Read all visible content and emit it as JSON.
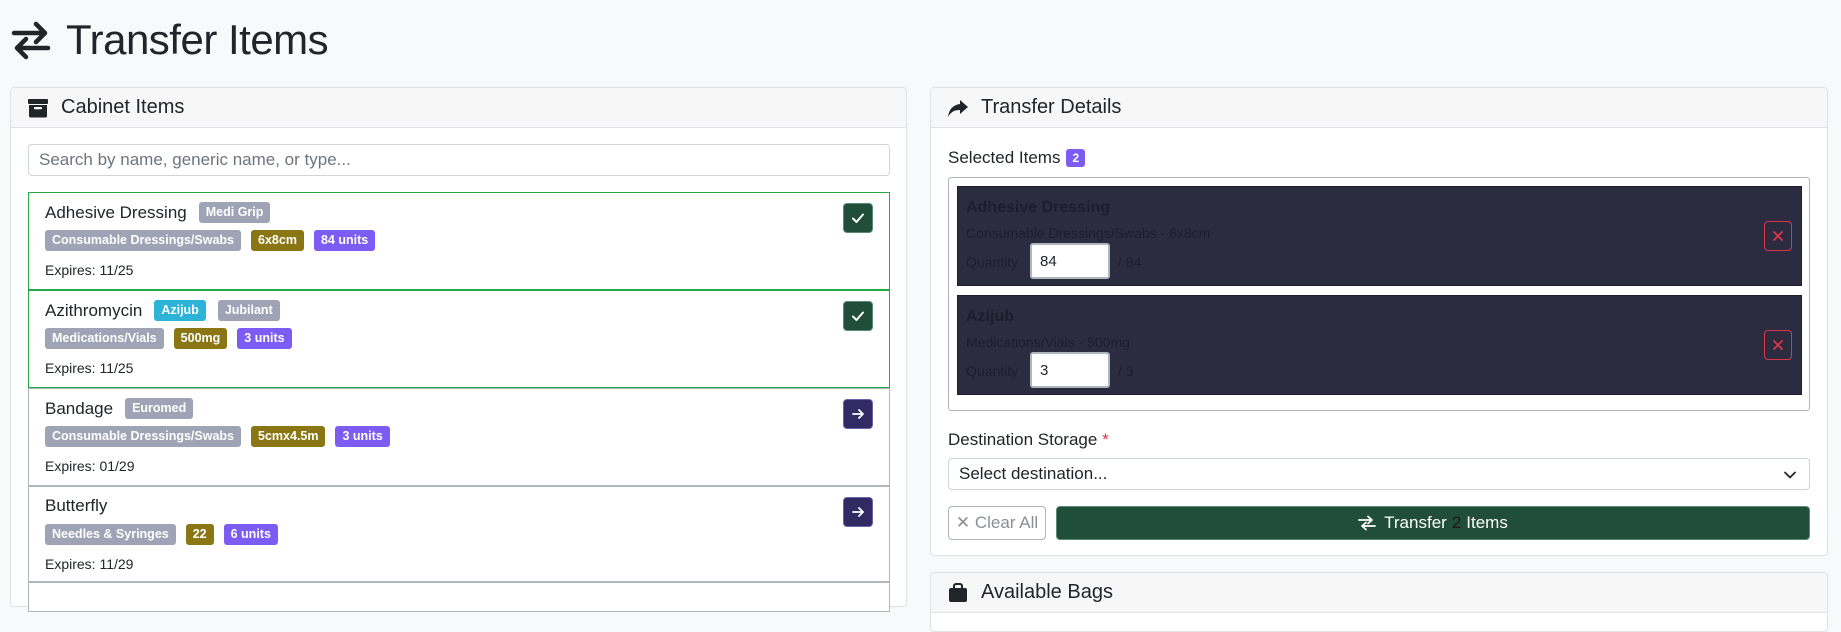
{
  "page": {
    "title": "Transfer Items",
    "icon": "transfer-arrows-icon"
  },
  "cabinet": {
    "title": "Cabinet Items",
    "icon": "archive-box-icon",
    "search_placeholder": "Search by name, generic name, or type...",
    "items": [
      {
        "name": "Adhesive Dressing",
        "tags": [
          "Medi Grip"
        ],
        "category": "Consumable Dressings/Swabs",
        "size": "6x8cm",
        "units": "84 units",
        "expires": "Expires: 11/25",
        "selected": true
      },
      {
        "name": "Azithromycin",
        "tags": [
          "Azijub",
          "Jubilant"
        ],
        "category": "Medications/Vials",
        "size": "500mg",
        "units": "3 units",
        "expires": "Expires: 11/25",
        "selected": true
      },
      {
        "name": "Bandage",
        "tags": [
          "Euromed"
        ],
        "category": "Consumable Dressings/Swabs",
        "size": "5cmx4.5m",
        "units": "3 units",
        "expires": "Expires: 01/29",
        "selected": false
      },
      {
        "name": "Butterfly",
        "tags": [],
        "category": "Needles & Syringes",
        "size": "22",
        "units": "6 units",
        "expires": "Expires: 11/29",
        "selected": false
      }
    ]
  },
  "transfer": {
    "title": "Transfer Details",
    "icon": "share-arrow-icon",
    "selected_label": "Selected Items",
    "selected_count": "2",
    "selected_items": [
      {
        "name": "Adhesive Dressing",
        "desc": "Consumable Dressings/Swabs - 6x8cm",
        "qty_label": "Quantity",
        "qty_value": "84",
        "qty_max": "/ 84"
      },
      {
        "name": "Azijub",
        "desc": "Medications/Vials - 500mg",
        "qty_label": "Quantity",
        "qty_value": "3",
        "qty_max": "/ 3"
      }
    ],
    "destination_label": "Destination Storage",
    "required_mark": "*",
    "destination_value": "Select destination...",
    "clear_label": "✕ Clear All",
    "transfer_prefix": "Transfer",
    "transfer_count": "2",
    "transfer_suffix": "Items"
  },
  "bags": {
    "title": "Available Bags",
    "icon": "bag-icon"
  },
  "colors": {
    "accent_green": "#214d3b",
    "accent_purple": "#7c5cf2",
    "danger": "#dc3545"
  }
}
